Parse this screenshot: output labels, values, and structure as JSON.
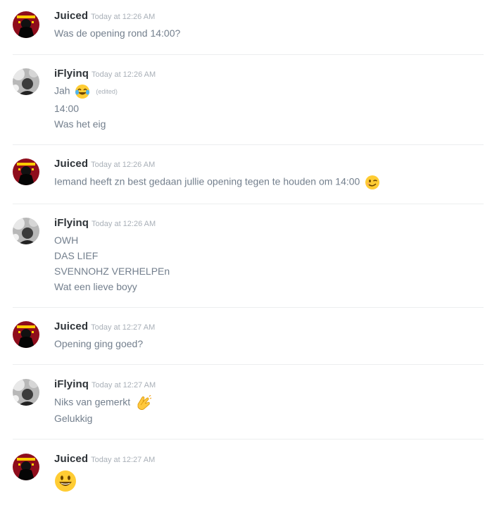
{
  "messages": [
    {
      "author": "Juiced",
      "timestamp": "Today at 12:26 AM",
      "lines": [
        "Was de opening rond 14:00?"
      ]
    },
    {
      "author": "iFlyinq",
      "timestamp": "Today at 12:26 AM",
      "lines": [
        "Jah",
        "14:00",
        "Was het eig"
      ],
      "edited_label": "(edited)",
      "emojis": [
        "joy-emoji"
      ]
    },
    {
      "author": "Juiced",
      "timestamp": "Today at 12:26 AM",
      "lines": [
        "Iemand heeft zn best gedaan jullie opening tegen te houden om 14:00"
      ],
      "emojis": [
        "wink-emoji"
      ]
    },
    {
      "author": "iFlyinq",
      "timestamp": "Today at 12:26 AM",
      "lines": [
        "OWH",
        "DAS LIEF",
        "SVENNOHZ VERHELPEn",
        "Wat een lieve boyy"
      ]
    },
    {
      "author": "Juiced",
      "timestamp": "Today at 12:27 AM",
      "lines": [
        "Opening ging goed?"
      ]
    },
    {
      "author": "iFlyinq",
      "timestamp": "Today at 12:27 AM",
      "lines": [
        "Niks van gemerkt",
        "Gelukkig"
      ],
      "emojis": [
        "clapping-hands-emoji"
      ]
    },
    {
      "author": "Juiced",
      "timestamp": "Today at 12:27 AM",
      "lines": [],
      "emojis": [
        "smiley-emoji"
      ]
    }
  ],
  "colors": {
    "username": "#2e3338",
    "message_text": "#737f8d",
    "timestamp": "#a9b0b8",
    "divider": "#eceeef"
  }
}
